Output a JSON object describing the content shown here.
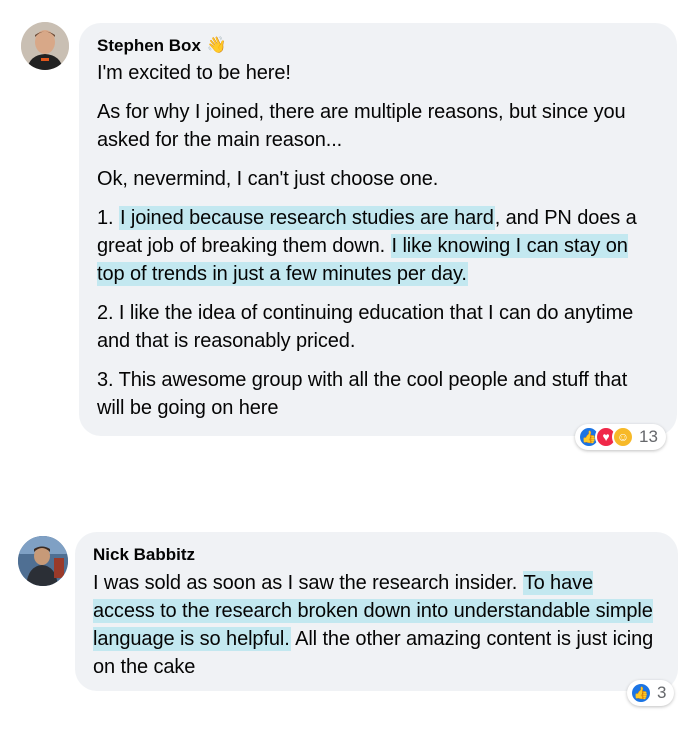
{
  "comments": [
    {
      "author": "Stephen Box",
      "badge_icon": "waving-hand-icon",
      "paragraphs": [
        {
          "segments": [
            {
              "text": "I'm excited to be here!",
              "hl": false
            }
          ]
        },
        {
          "segments": [
            {
              "text": "As for why I joined, there are multiple reasons, but since you asked for the main reason...",
              "hl": false
            }
          ]
        },
        {
          "segments": [
            {
              "text": "Ok, nevermind, I can't just choose one.",
              "hl": false
            }
          ]
        },
        {
          "segments": [
            {
              "text": "1. ",
              "hl": false
            },
            {
              "text": "I joined because research studies are hard",
              "hl": true
            },
            {
              "text": ", and PN does a great job of breaking them down. ",
              "hl": false
            },
            {
              "text": "I like knowing I can stay on top of trends in just a few minutes per day.",
              "hl": true
            }
          ]
        },
        {
          "segments": [
            {
              "text": "2. I like the idea of continuing education that I can do anytime and that is reasonably priced.",
              "hl": false
            }
          ]
        },
        {
          "segments": [
            {
              "text": "3. This awesome group with all the cool people and stuff that will be going on here",
              "hl": false
            }
          ]
        }
      ],
      "reactions": {
        "icons": [
          "like-icon",
          "love-icon",
          "care-icon"
        ],
        "count": "13"
      }
    },
    {
      "author": "Nick Babbitz",
      "paragraphs": [
        {
          "segments": [
            {
              "text": "I was sold as soon as I saw the research insider. ",
              "hl": false
            },
            {
              "text": "To have access to the research broken down into understandable simple language is so helpful.",
              "hl": true
            },
            {
              "text": " All the other amazing content is just icing on the cake",
              "hl": false
            }
          ]
        }
      ],
      "reactions": {
        "icons": [
          "like-icon"
        ],
        "count": "3"
      }
    }
  ],
  "colors": {
    "bubble": "#f0f2f5",
    "highlight": "#c3e8f0",
    "like": "#1b74e4",
    "love": "#f02849",
    "care": "#f7b928"
  }
}
